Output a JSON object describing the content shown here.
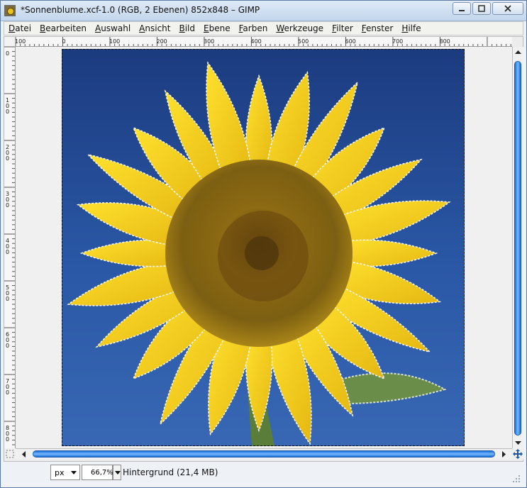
{
  "window": {
    "title": "*Sonnenblume.xcf-1.0 (RGB, 2 Ebenen) 852x848 – GIMP"
  },
  "menu": [
    "Datei",
    "Bearbeiten",
    "Auswahl",
    "Ansicht",
    "Bild",
    "Ebene",
    "Farben",
    "Werkzeuge",
    "Filter",
    "Fenster",
    "Hilfe"
  ],
  "hruler_labels": [
    "100",
    "0",
    "100",
    "200",
    "300",
    "400",
    "500",
    "600",
    "700",
    "800"
  ],
  "vruler_labels": [
    "0",
    "100",
    "200",
    "300",
    "400",
    "500",
    "600",
    "700",
    "800"
  ],
  "statusbar": {
    "unit": "px",
    "zoom": "66,7%",
    "layer_info": "Hintergrund (21,4 MB)"
  },
  "image": {
    "sky_colors": [
      "#1c3b7f",
      "#3867b4"
    ],
    "petal_color": "#f2cf1b",
    "disk_color": "#8a6a14"
  }
}
